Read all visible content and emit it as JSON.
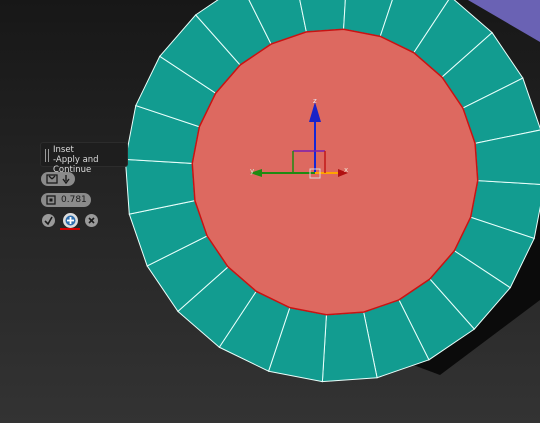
{
  "tooltip": {
    "title": "Inset",
    "subtitle": "-Apply and Continue"
  },
  "caddy": {
    "mode_icons": [
      "mirror-vertex-icon",
      "arrow-icon"
    ],
    "amount_icon": "inset-amount-icon",
    "amount_value": "0.781",
    "buttons": [
      {
        "name": "ok-button",
        "icon": "check-icon"
      },
      {
        "name": "apply-and-continue-button",
        "icon": "plus-icon",
        "active": true
      },
      {
        "name": "cancel-button",
        "icon": "x-icon"
      }
    ]
  },
  "gizmo": {
    "axis_x": "x",
    "axis_y": "y",
    "axis_z": "z"
  },
  "colors": {
    "cylinder_side": "#129c90",
    "selected_face": "#dd6960",
    "selection_edge": "#c91212",
    "background_top": "#171717",
    "background_bottom": "#333333",
    "accent_purple": "#6a62b4"
  }
}
